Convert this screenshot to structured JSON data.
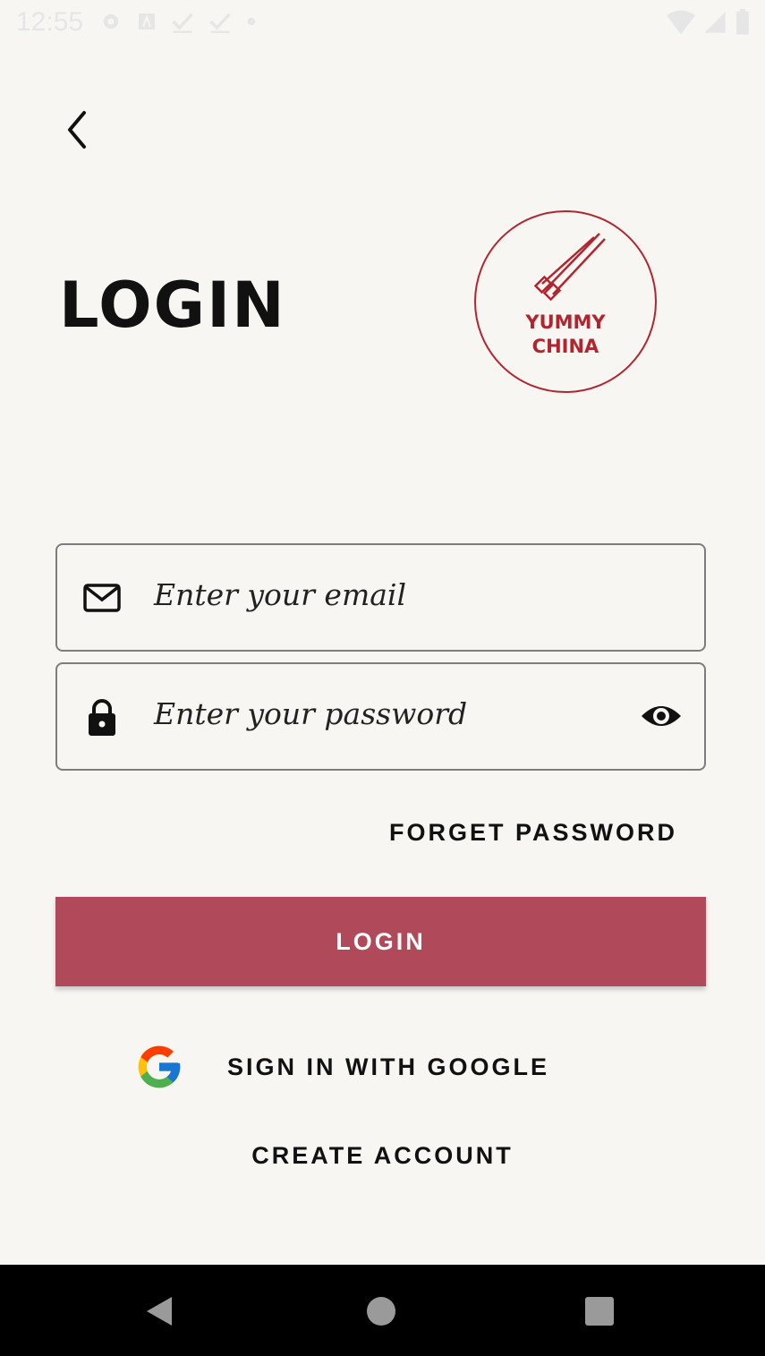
{
  "status_bar": {
    "time": "12:55"
  },
  "header": {
    "title": "LOGIN"
  },
  "logo": {
    "line1": "YUMMY",
    "line2": "CHINA"
  },
  "form": {
    "email_placeholder": "Enter your email",
    "password_placeholder": "Enter your password"
  },
  "actions": {
    "forget_password": "FORGET PASSWORD",
    "login": "LOGIN",
    "google": "SIGN IN WITH GOOGLE",
    "create_account": "CREATE ACCOUNT"
  },
  "colors": {
    "background": "#f7f6f3",
    "primary_button": "#b04a5a",
    "logo_red": "#b0262f"
  },
  "icons": [
    "back-arrow-icon",
    "mail-icon",
    "lock-icon",
    "eye-icon",
    "google-icon",
    "settings-icon",
    "wifi-icon",
    "signal-icon",
    "battery-icon"
  ]
}
